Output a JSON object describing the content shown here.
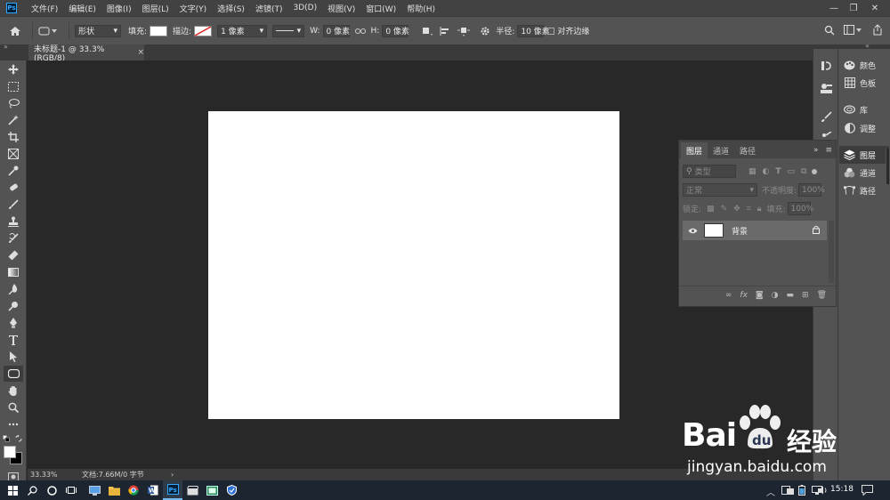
{
  "app": {
    "logo_text": "Ps"
  },
  "menubar": {
    "items": [
      "文件(F)",
      "编辑(E)",
      "图像(I)",
      "图层(L)",
      "文字(Y)",
      "选择(S)",
      "滤镜(T)",
      "3D(D)",
      "视图(V)",
      "窗口(W)",
      "帮助(H)"
    ],
    "window_controls": [
      "—",
      "❐",
      "✕"
    ]
  },
  "options": {
    "shape_mode": "形状",
    "fill_label": "填充:",
    "stroke_label": "描边:",
    "stroke_width": "1 像素",
    "w_label": "W:",
    "w_value": "0 像素",
    "h_label": "H:",
    "h_value": "0 像素",
    "radius_label": "半径:",
    "radius_value": "10 像素",
    "align_edges_label": "对齐边缘"
  },
  "document": {
    "tab_title": "未标题-1 @ 33.3%(RGB/8)",
    "tab_close": "×"
  },
  "statusbar": {
    "zoom": "33.33%",
    "doc_info": "文档:7.66M/0 字节",
    "arrow": "›"
  },
  "right_strip": {
    "items": [
      {
        "icon": "palette-icon",
        "label": "颜色"
      },
      {
        "icon": "swatches-icon",
        "label": "色板"
      },
      {
        "icon": "libraries-icon",
        "label": "库"
      },
      {
        "icon": "adjustments-icon",
        "label": "调整"
      },
      {
        "icon": "layers-icon",
        "label": "图层"
      },
      {
        "icon": "channels-icon",
        "label": "通道"
      },
      {
        "icon": "paths-icon",
        "label": "路径"
      }
    ]
  },
  "layers_panel": {
    "tabs": [
      "图层",
      "通道",
      "路径"
    ],
    "filter_placeholder": "类型",
    "blend_mode": "正常",
    "opacity_label": "不透明度:",
    "opacity_value": "100%",
    "lock_label": "锁定:",
    "fill_label": "填充:",
    "fill_value": "100%",
    "layers": [
      {
        "name": "背景",
        "visible": true,
        "locked": true
      }
    ],
    "footer_icons": [
      "link-icon",
      "fx-icon",
      "mask-icon",
      "adjustment-layer-icon",
      "group-icon",
      "new-layer-icon",
      "trash-icon"
    ],
    "fx_text": "fx"
  },
  "taskbar": {
    "time": "15:18"
  },
  "watermark": {
    "brand_left": "Bai",
    "brand_right": "经验",
    "url": "jingyan.baidu.com"
  },
  "colors": {
    "menubar_bg": "#424242",
    "panel_bg": "#535353",
    "workspace_bg": "#282828",
    "canvas": "#ffffff",
    "taskbar_bg": "#1d2530",
    "ps_blue": "#31a8ff"
  }
}
